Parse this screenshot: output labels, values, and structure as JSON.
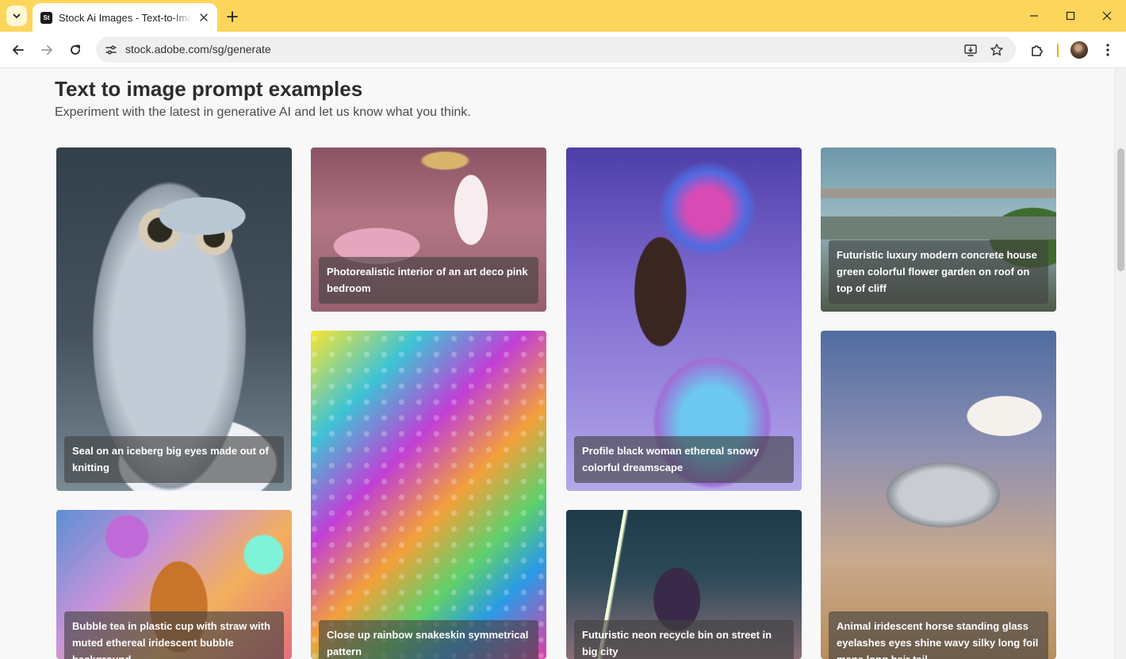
{
  "browser": {
    "tab_title": "Stock Ai Images - Text-to-Image",
    "favicon_text": "St",
    "url": "stock.adobe.com/sg/generate"
  },
  "page": {
    "heading": "Text to image prompt examples",
    "subheading": "Experiment with the latest in generative AI and let us know what you think."
  },
  "cards": [
    {
      "caption": "Seal on an iceberg big eyes made out of knitting"
    },
    {
      "caption": "Photorealistic interior of an art deco pink bedroom"
    },
    {
      "caption": "Close up rainbow snakeskin symmetrical pattern"
    },
    {
      "caption": "Profile black woman ethereal snowy colorful dreamscape"
    },
    {
      "caption": "Futuristic luxury modern concrete house green colorful flower garden on roof on top of cliff"
    },
    {
      "caption": "Animal iridescent horse standing glass eyelashes eyes shine wavy silky long foil mane long hair tail"
    },
    {
      "caption": "Bubble tea in plastic cup with straw with muted ethereal iridescent bubble background"
    },
    {
      "caption": "Futuristic neon recycle bin on street in big city"
    }
  ],
  "icons": {
    "tab_search": "chevron-down-icon",
    "tab_close": "close-icon",
    "new_tab": "plus-icon",
    "back": "arrow-left-icon",
    "forward": "arrow-right-icon",
    "reload": "reload-icon",
    "site_info": "tune-icon",
    "install": "install-app-icon",
    "bookmark": "star-icon",
    "extensions": "puzzle-icon",
    "menu": "kebab-menu-icon"
  },
  "colors": {
    "titlebar": "#fcd55b",
    "page_background": "#f8f8f8",
    "caption_background": "rgba(64,64,64,0.62)"
  }
}
